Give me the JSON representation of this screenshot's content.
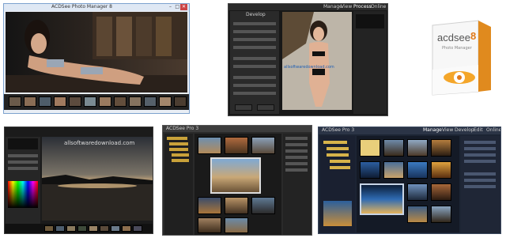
{
  "screenshots": {
    "top_left": {
      "title_bar": "ACDSee Photo Manager 8",
      "window_controls": [
        "–",
        "□",
        "✕"
      ]
    },
    "top_middle": {
      "tabs": [
        "Manage",
        "View",
        "Process",
        "Online"
      ],
      "panel_title": "Develop",
      "watermark": "allsoftwaredownload.com"
    },
    "top_right": {
      "box_brand": "acdsee",
      "box_version": "8",
      "box_subtitle": "Photo Manager"
    },
    "bottom_left": {
      "watermark": "allsoftwaredownload.com"
    },
    "bottom_middle": {
      "title": "ACDSee Pro 3"
    },
    "bottom_right": {
      "title": "ACDSee Pro 3",
      "tabs": [
        "Manage",
        "View",
        "Develop",
        "Edit",
        "Online"
      ]
    }
  }
}
